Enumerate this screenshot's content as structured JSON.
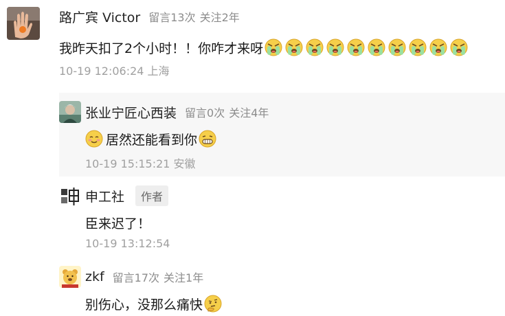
{
  "main": {
    "author": "路广宾 Victor",
    "comment_count_label": "留言13次",
    "follow_label": "关注2年",
    "text": "我昨天扣了2个小时！！你咋才来呀",
    "emoji_name": "crying-face-icon",
    "emoji_count": 10,
    "time": "10-19 12:06:24 上海"
  },
  "replies": [
    {
      "author": "张业宁匠心西装",
      "comment_count_label": "留言0次",
      "follow_label": "关注4年",
      "leading_emoji": "smile-icon",
      "text": "居然还能看到你",
      "trailing_emoji": "grin-icon",
      "time": "10-19 15:15:21 安徽"
    },
    {
      "author": "申工社",
      "badge": "作者",
      "text": "臣来迟了！",
      "time": "10-19 13:12:54"
    },
    {
      "author": "zkf",
      "comment_count_label": "留言17次",
      "follow_label": "关注1年",
      "text": "别伤心，没那么痛快",
      "trailing_emoji": "thinking-face-icon"
    }
  ],
  "colors": {
    "reply_highlight_bg": "#f7f7f7",
    "meta_text": "#8c8c8c",
    "time_text": "#a0a0a0",
    "emoji_face": "#f6cf4a",
    "cry_face": "#9be0a0"
  }
}
